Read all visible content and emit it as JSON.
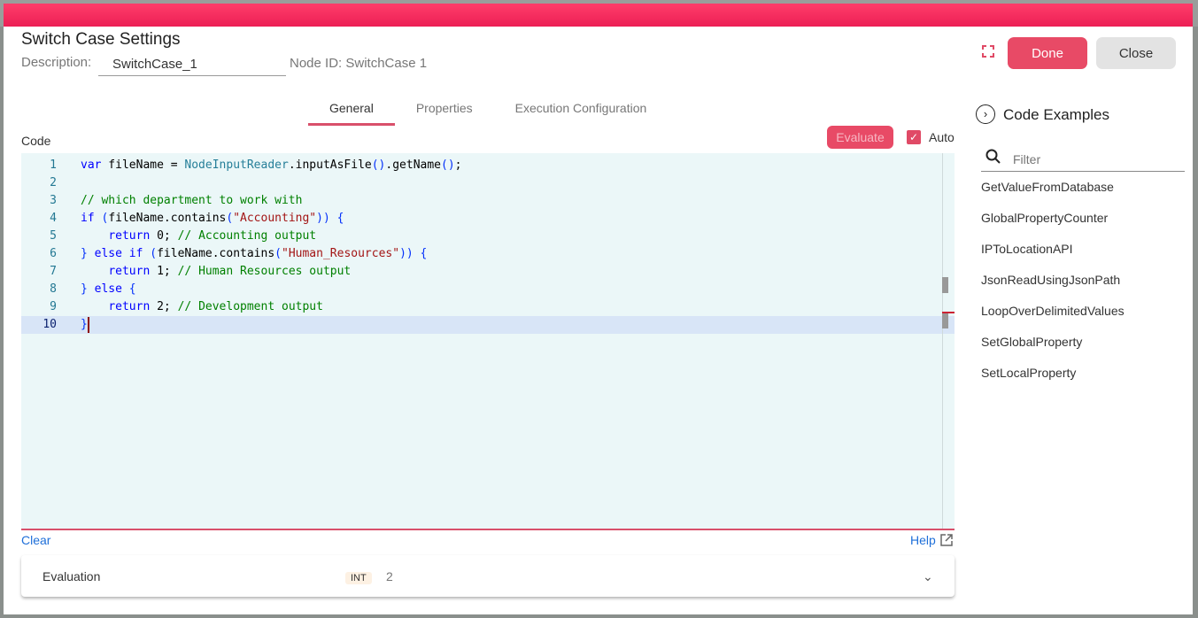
{
  "dialog": {
    "title": "Switch Case Settings",
    "description_label": "Description:",
    "description_value": "SwitchCase_1",
    "node_id": "Node ID: SwitchCase  1",
    "done_label": "Done",
    "close_label": "Close"
  },
  "tabs": [
    {
      "label": "General",
      "active": true
    },
    {
      "label": "Properties"
    },
    {
      "label": "Execution Configuration"
    }
  ],
  "code": {
    "label": "Code",
    "evaluate_label": "Evaluate",
    "auto_label": "Auto",
    "auto_checked": true,
    "current_line": 10,
    "lines": [
      [
        [
          "k",
          "var"
        ],
        [
          "t",
          " fileName = "
        ],
        [
          "c",
          "NodeInputReader"
        ],
        [
          "t",
          ".inputAsFile"
        ],
        [
          "p",
          "()"
        ],
        [
          "t",
          ".getName"
        ],
        [
          "p",
          "()"
        ],
        [
          "t",
          ";"
        ]
      ],
      [],
      [
        [
          "m",
          "// which department to work with"
        ]
      ],
      [
        [
          "k",
          "if"
        ],
        [
          "t",
          " "
        ],
        [
          "p",
          "("
        ],
        [
          "t",
          "fileName.contains"
        ],
        [
          "p",
          "("
        ],
        [
          "s",
          "\"Accounting\""
        ],
        [
          "p",
          "))"
        ],
        [
          "t",
          " "
        ],
        [
          "p",
          "{"
        ]
      ],
      [
        [
          "t",
          "    "
        ],
        [
          "k",
          "return"
        ],
        [
          "t",
          " 0; "
        ],
        [
          "m",
          "// Accounting output"
        ]
      ],
      [
        [
          "p",
          "}"
        ],
        [
          "t",
          " "
        ],
        [
          "k",
          "else if"
        ],
        [
          "t",
          " "
        ],
        [
          "p",
          "("
        ],
        [
          "t",
          "fileName.contains"
        ],
        [
          "p",
          "("
        ],
        [
          "s",
          "\"Human_Resources\""
        ],
        [
          "p",
          "))"
        ],
        [
          "t",
          " "
        ],
        [
          "p",
          "{"
        ]
      ],
      [
        [
          "t",
          "    "
        ],
        [
          "k",
          "return"
        ],
        [
          "t",
          " 1; "
        ],
        [
          "m",
          "// Human Resources output"
        ]
      ],
      [
        [
          "p",
          "}"
        ],
        [
          "t",
          " "
        ],
        [
          "k",
          "else"
        ],
        [
          "t",
          " "
        ],
        [
          "p",
          "{"
        ]
      ],
      [
        [
          "t",
          "    "
        ],
        [
          "k",
          "return"
        ],
        [
          "t",
          " 2; "
        ],
        [
          "m",
          "// Development output"
        ]
      ],
      [
        [
          "p",
          "}"
        ]
      ]
    ],
    "clear_label": "Clear",
    "help_label": "Help"
  },
  "evaluation": {
    "label": "Evaluation",
    "type": "INT",
    "value": "2"
  },
  "code_examples": {
    "title": "Code Examples",
    "filter_placeholder": "Filter",
    "items": [
      "GetValueFromDatabase",
      "GlobalPropertyCounter",
      "IPToLocationAPI",
      "JsonReadUsingJsonPath",
      "LoopOverDelimitedValues",
      "SetGlobalProperty",
      "SetLocalProperty"
    ]
  },
  "colors": {
    "accent": "#e84a66",
    "topbar": "#ff3d6a",
    "link": "#1e6fd9"
  }
}
